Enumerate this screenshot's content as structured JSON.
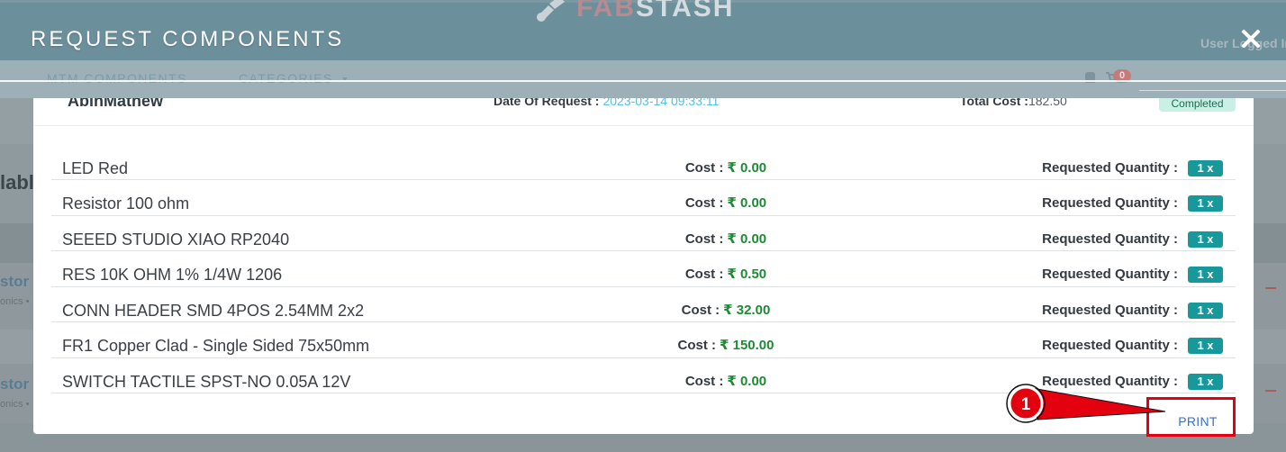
{
  "app": {
    "logo_fab": "FAB",
    "logo_stash": "STASH",
    "user_status": "User Logged In"
  },
  "nav": {
    "items": [
      {
        "label": "MTM COMPONENTS"
      },
      {
        "label": "CATEGORIES",
        "dropdown": true
      }
    ],
    "cart_count": "0"
  },
  "background_page": {
    "heading_fragment": "labl",
    "rows": [
      {
        "title_fragment": "stor",
        "subtitle_fragment": "onics •"
      },
      {
        "title_fragment": "stor",
        "subtitle_fragment": "onics •"
      }
    ]
  },
  "modal": {
    "title": "REQUEST COMPONENTS",
    "request": {
      "name": "AbinMathew",
      "date_label": "Date Of Request :",
      "date_value": "2023-03-14 09:33:11",
      "total_label": "Total Cost :",
      "total_value": "182.50",
      "status": "Completed"
    },
    "cost_label": "Cost :",
    "quantity_label": "Requested Quantity :",
    "items": [
      {
        "name": "LED Red",
        "cost": "₹ 0.00",
        "quantity": "1 x"
      },
      {
        "name": "Resistor 100 ohm",
        "cost": "₹ 0.00",
        "quantity": "1 x"
      },
      {
        "name": "SEEED STUDIO XIAO RP2040",
        "cost": "₹ 0.00",
        "quantity": "1 x"
      },
      {
        "name": "RES 10K OHM 1% 1/4W 1206",
        "cost": "₹ 0.50",
        "quantity": "1 x"
      },
      {
        "name": "CONN HEADER SMD 4POS 2.54MM 2x2",
        "cost": "₹ 32.00",
        "quantity": "1 x"
      },
      {
        "name": "FR1 Copper Clad - Single Sided 75x50mm",
        "cost": "₹ 150.00",
        "quantity": "1 x"
      },
      {
        "name": "SWITCH TACTILE SPST-NO 0.05A 12V",
        "cost": "₹ 0.00",
        "quantity": "1 x"
      }
    ],
    "print_label": "PRINT"
  },
  "annotation": {
    "step_number": "1"
  },
  "icons": {
    "logo": "robot-arm-icon",
    "close": "close-icon",
    "dropdown": "chevron-down-icon",
    "bag": "shopping-bag-icon",
    "cart": "cart-icon",
    "remove": "remove-icon"
  },
  "colors": {
    "header_bar": "#6c8f9c",
    "nav_strip": "#9db0b8",
    "accent_teal": "#17999b",
    "cost_green": "#1d8a34",
    "date_blue": "#56bfe3",
    "status_badge_bg": "#c8f1e3",
    "print_blue": "#3a6fc4",
    "annotation_red": "#e3000f"
  }
}
